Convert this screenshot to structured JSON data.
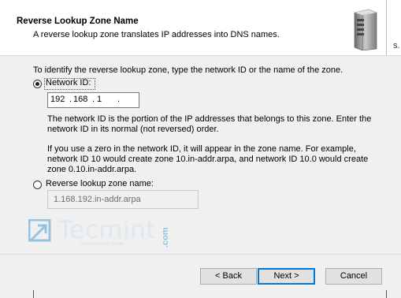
{
  "header": {
    "title": "Reverse Lookup Zone Name",
    "subtitle": "A reverse lookup zone translates IP addresses into DNS names.",
    "edge_text": "s."
  },
  "intro_text": "To identify the reverse lookup zone, type the network ID or the name of the zone.",
  "network_id": {
    "label": "Network ID:",
    "selected": true,
    "octets": [
      "192",
      "168",
      "1",
      ""
    ]
  },
  "network_id_help": {
    "line1": "The network ID is the portion of the IP addresses that belongs to this zone. Enter the",
    "line2": "network ID in its normal (not reversed) order.",
    "line3": "If you use a zero in the network ID, it will appear in the zone name. For example,",
    "line4": "network ID 10 would create zone 10.in-addr.arpa, and network ID 10.0 would create",
    "line5": "zone 0.10.in-addr.arpa."
  },
  "zone_name": {
    "label": "Reverse lookup zone name:",
    "selected": false,
    "value": "1.168.192.in-addr.arpa"
  },
  "watermark": {
    "brand": "Tecmint",
    "suffix": ".com",
    "tagline": "Linux Howto's Guide"
  },
  "buttons": {
    "back": "< Back",
    "next": "Next >",
    "cancel": "Cancel"
  }
}
